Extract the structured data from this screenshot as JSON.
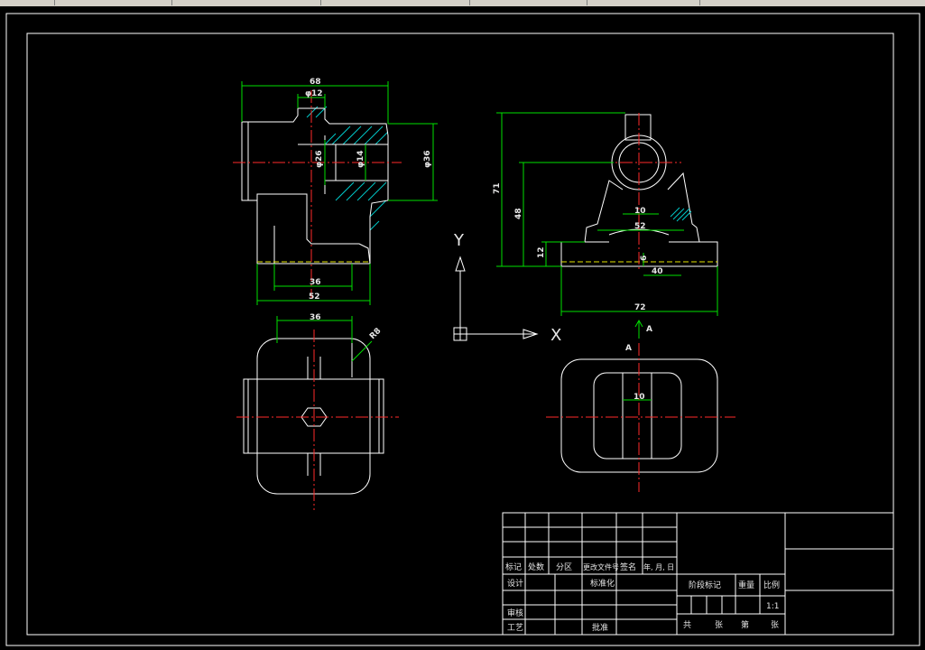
{
  "views": {
    "front": {
      "dim_width": "68",
      "dim_bore": "φ12",
      "dim_od": "φ26",
      "dim_id": "φ14",
      "dim_outer": "φ36",
      "dim_base_inner": "36",
      "dim_base_outer": "52"
    },
    "side": {
      "dim_height": "71",
      "dim_center": "48",
      "dim_base_h": "12",
      "dim_slot": "10",
      "dim_span": "52",
      "dim_small": "6",
      "dim_offset": "40",
      "dim_total": "72"
    },
    "top": {
      "dim_width": "36",
      "dim_radius": "R8"
    },
    "section": {
      "label_a1": "A",
      "label_a2": "A",
      "dim_slot": "10"
    }
  },
  "ucs": {
    "y_label": "Y",
    "x_label": "X"
  },
  "title_block": {
    "row_header": [
      "标记",
      "处数",
      "分区",
      "更改文件号",
      "签名",
      "年, 月, 日"
    ],
    "design": "设计",
    "standard": "标准化",
    "review": "审核",
    "process": "工艺",
    "approve": "批准",
    "stage_mark": "阶段标记",
    "weight": "重量",
    "scale_label": "比例",
    "scale_value": "1:1",
    "total": "共",
    "sheets1": "张",
    "page": "第",
    "sheets2": "张"
  },
  "colors": {
    "background": "#000000",
    "outline": "#ffffff",
    "dimension": "#00e000",
    "centerline": "#ff2a2a",
    "hatch": "#00c8c8",
    "hidden": "#e6e600"
  }
}
